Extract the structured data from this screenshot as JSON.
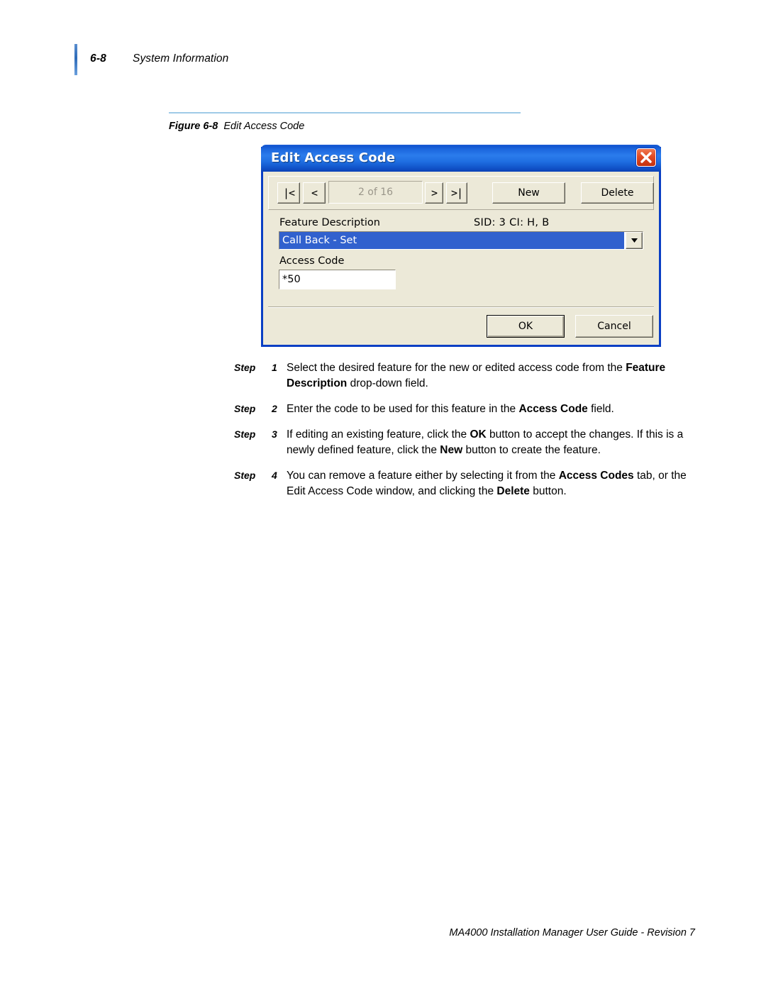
{
  "header": {
    "folio": "6-8",
    "title": "System Information"
  },
  "figure": {
    "label": "Figure 6-8",
    "caption": "Edit Access Code"
  },
  "dialog": {
    "title": "Edit Access Code",
    "close_icon": "close-x-icon",
    "navigation": {
      "first_label": "|<",
      "prev_label": "<",
      "counter": "2 of 16",
      "next_label": ">",
      "last_label": ">|"
    },
    "new_label": "New",
    "delete_label": "Delete",
    "feature_description_label": "Feature Description",
    "sid_info": "SID: 3    CI: H, B",
    "feature_description_value": "Call Back - Set",
    "dropdown_icon": "chevron-down-icon",
    "access_code_label": "Access Code",
    "access_code_value": "*50",
    "ok_label": "OK",
    "cancel_label": "Cancel",
    "colors": {
      "titlebar_blue": "#1b66dd",
      "border_blue": "#0a3fc4",
      "face": "#ece9d8",
      "selection_blue": "#3161ce",
      "close_red": "#e14a23"
    }
  },
  "steps": [
    {
      "label": "Step",
      "number": "1",
      "parts": [
        {
          "text": "Select the desired feature for the new or edited access code from the ",
          "bold": false
        },
        {
          "text": "Feature Description",
          "bold": true
        },
        {
          "text": " drop-down field.",
          "bold": false
        }
      ]
    },
    {
      "label": "Step",
      "number": "2",
      "parts": [
        {
          "text": "Enter the code to be used for this feature in the ",
          "bold": false
        },
        {
          "text": "Access Code",
          "bold": true
        },
        {
          "text": " field.",
          "bold": false
        }
      ]
    },
    {
      "label": "Step",
      "number": "3",
      "parts": [
        {
          "text": "If editing an existing feature, click the ",
          "bold": false
        },
        {
          "text": "OK",
          "bold": true
        },
        {
          "text": " button to accept the changes. If this is a newly defined feature, click the ",
          "bold": false
        },
        {
          "text": "New",
          "bold": true
        },
        {
          "text": " button to create the feature.",
          "bold": false
        }
      ]
    },
    {
      "label": "Step",
      "number": "4",
      "parts": [
        {
          "text": "You can remove a feature either by selecting it from the ",
          "bold": false
        },
        {
          "text": "Access Codes",
          "bold": true
        },
        {
          "text": " tab, or the Edit Access Code window, and clicking the ",
          "bold": false
        },
        {
          "text": "Delete",
          "bold": true
        },
        {
          "text": " button.",
          "bold": false
        }
      ]
    }
  ],
  "footer": {
    "text": "MA4000 Installation Manager User Guide - Revision 7"
  }
}
